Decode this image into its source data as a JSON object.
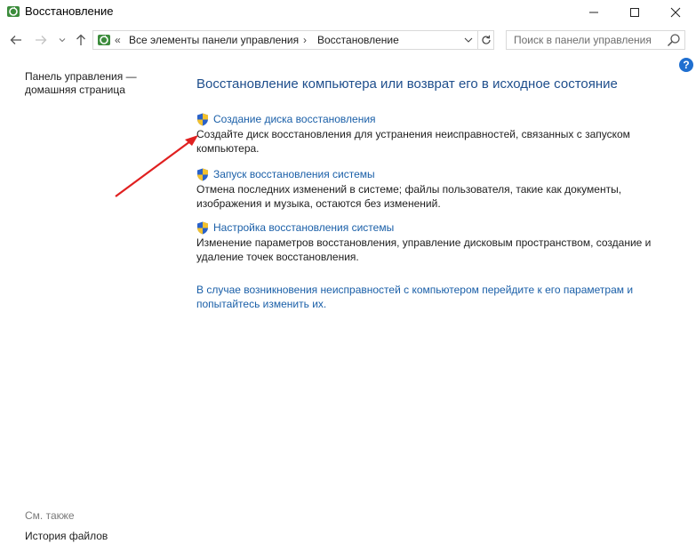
{
  "window": {
    "title": "Восстановление",
    "minimize_icon": "minimize-icon",
    "maximize_icon": "maximize-icon",
    "close_icon": "close-icon"
  },
  "nav": {
    "back_icon": "arrow-left-icon",
    "forward_icon": "arrow-right-icon",
    "recent_icon": "chevron-down-icon",
    "up_icon": "arrow-up-icon",
    "address": {
      "overflow": "«",
      "breadcrumb": [
        "Все элементы панели управления",
        "Восстановление"
      ],
      "separator": "›"
    },
    "search": {
      "placeholder": "Поиск в панели управления",
      "value": ""
    }
  },
  "sidebar": {
    "home_link": "Панель управления — домашняя страница",
    "see_also_label": "См. также",
    "see_also_items": [
      "История файлов"
    ]
  },
  "main": {
    "title": "Восстановление компьютера или возврат его в исходное состояние",
    "tasks": [
      {
        "link": "Создание диска восстановления",
        "description": "Создайте диск восстановления для устранения неисправностей, связанных с запуском компьютера."
      },
      {
        "link": "Запуск восстановления системы",
        "description": "Отмена последних изменений в системе; файлы пользователя, такие как документы, изображения и музыка, остаются без изменений."
      },
      {
        "link": "Настройка восстановления системы",
        "description": "Изменение параметров восстановления, управление дисковым пространством, создание и удаление точек восстановления."
      }
    ],
    "bottom_link": "В случае возникновения неисправностей с компьютером перейдите к его параметрам и попытайтесь изменить их."
  },
  "help_icon": "?",
  "colors": {
    "link": "#1a5fa8",
    "title": "#1e4e8c",
    "annotation_arrow": "#e02020"
  }
}
